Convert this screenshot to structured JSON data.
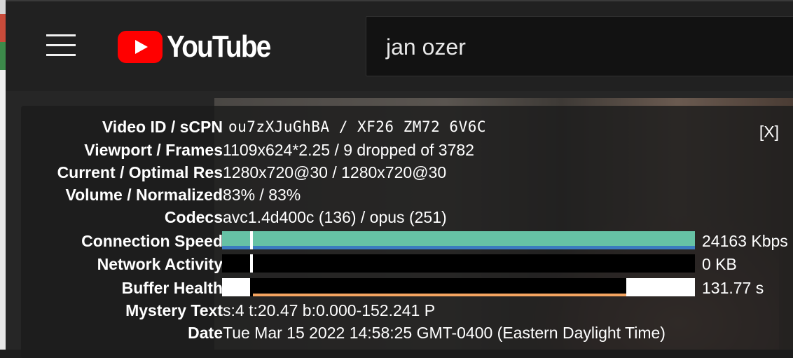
{
  "header": {
    "logo_text": "YouTube",
    "search_value": "jan ozer"
  },
  "stats": {
    "close_label": "[X]",
    "rows": {
      "video_id": {
        "label": "Video ID / sCPN",
        "value": "ou7zXJuGhBA / XF26 ZM72 6V6C"
      },
      "viewport": {
        "label": "Viewport / Frames",
        "value": "1109x624*2.25 / 9 dropped of 3782"
      },
      "res": {
        "label": "Current / Optimal Res",
        "value": "1280x720@30 / 1280x720@30"
      },
      "volume": {
        "label": "Volume / Normalized",
        "value": "83% / 83%"
      },
      "codecs": {
        "label": "Codecs",
        "value": "avc1.4d400c (136) / opus (251)"
      },
      "speed": {
        "label": "Connection Speed",
        "value": "24163 Kbps"
      },
      "network": {
        "label": "Network Activity",
        "value": "0 KB"
      },
      "buffer": {
        "label": "Buffer Health",
        "value": "131.77 s"
      },
      "mystery": {
        "label": "Mystery Text",
        "value": "s:4 t:20.47 b:0.000-152.241 P"
      },
      "date": {
        "label": "Date",
        "value": "Tue Mar 15 2022 14:58:25 GMT-0400 (Eastern Daylight Time)"
      }
    }
  },
  "colors": {
    "speed_fill": "#66c2a5",
    "speed_line": "#3b7bbf",
    "buffer_line": "#f4a460",
    "brand_red": "#ff0000"
  },
  "icons": [
    "menu-icon",
    "youtube-logo-icon"
  ]
}
